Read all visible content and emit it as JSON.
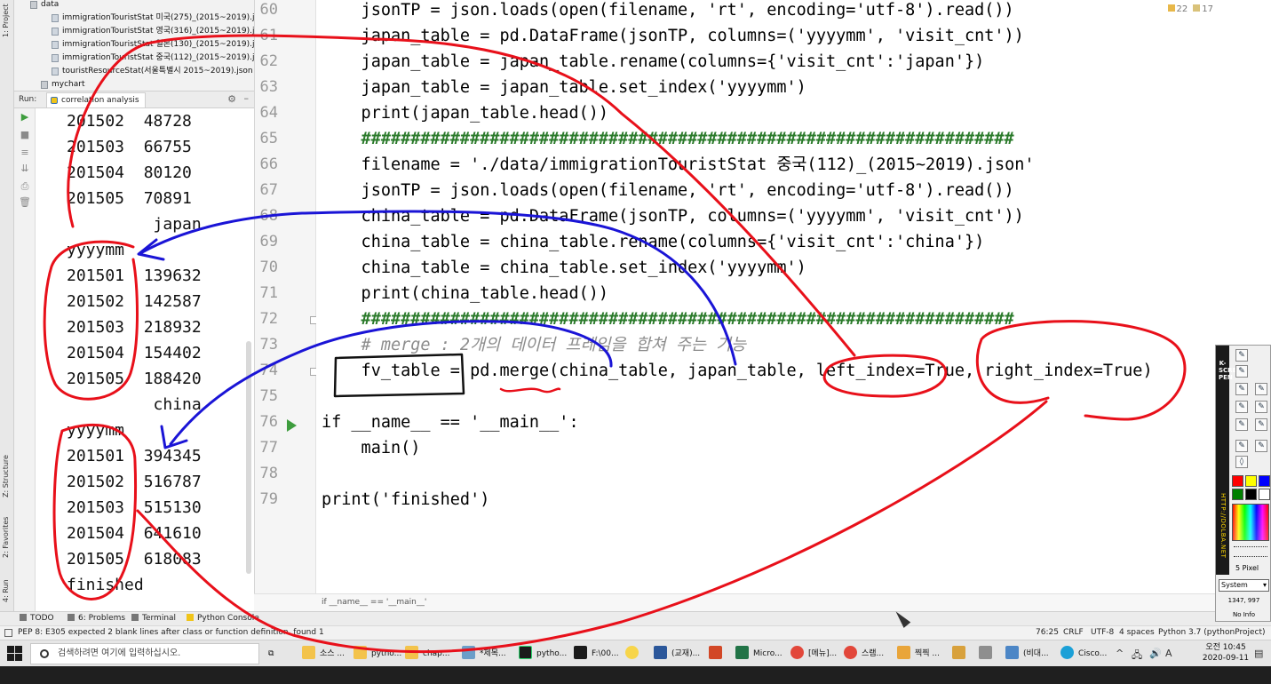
{
  "left_stripe": {
    "project_tab": "1: Project",
    "structure_tab": "Z: Structure",
    "favorites_tab": "2: Favorites",
    "run_tab": "4: Run"
  },
  "project_tree": {
    "items": [
      {
        "label": "data",
        "kind": "folder"
      },
      {
        "label": "immigrationTouristStat 미국(275)_(2015~2019).json",
        "kind": "file"
      },
      {
        "label": "immigrationTouristStat 영국(316)_(2015~2019).json",
        "kind": "file"
      },
      {
        "label": "immigrationTouristStat 일본(130)_(2015~2019).json",
        "kind": "file"
      },
      {
        "label": "immigrationTouristStat 중국(112)_(2015~2019).json",
        "kind": "file"
      },
      {
        "label": "touristResourceStat(서울특별시 2015~2019).json",
        "kind": "file"
      },
      {
        "label": "mychart",
        "kind": "folder"
      }
    ]
  },
  "run_panel": {
    "label": "Run:",
    "tab": "correlation analysis",
    "console_lines": [
      "201502  48728",
      "201503  66755",
      "201504  80120",
      "201505  70891",
      "         japan",
      "yyyymm",
      "201501  139632",
      "201502  142587",
      "201503  218932",
      "201504  154402",
      "201505  188420",
      "         china",
      "yyyymm",
      "201501  394345",
      "201502  516787",
      "201503  515130",
      "201504  641610",
      "201505  618083",
      "finished"
    ]
  },
  "editor": {
    "inspection": {
      "warnings": "22",
      "weak": "17"
    },
    "line_numbers": [
      "60",
      "61",
      "62",
      "63",
      "64",
      "65",
      "66",
      "67",
      "68",
      "69",
      "70",
      "71",
      "72",
      "73",
      "74",
      "75",
      "76",
      "77",
      "78",
      "79"
    ],
    "lines": [
      "    jsonTP = json.loads(open(filename, 'rt', encoding='utf-8').read())",
      "    japan_table = pd.DataFrame(jsonTP, columns=('yyyymm', 'visit_cnt'))",
      "    japan_table = japan_table.rename(columns={'visit_cnt':'japan'})",
      "    japan_table = japan_table.set_index('yyyymm')",
      "    print(japan_table.head())",
      "    ##################################################################",
      "    filename = './data/immigrationTouristStat 중국(112)_(2015~2019).json'",
      "    jsonTP = json.loads(open(filename, 'rt', encoding='utf-8').read())",
      "    china_table = pd.DataFrame(jsonTP, columns=('yyyymm', 'visit_cnt'))",
      "    china_table = china_table.rename(columns={'visit_cnt':'china'})",
      "    china_table = china_table.set_index('yyyymm')",
      "    print(china_table.head())",
      "    ##################################################################",
      "    # merge : 2개의 데이터 프레임을 합쳐 주는 기능",
      "    fv_table = pd.merge(china_table, japan_table, left_index=True, right_index=True)",
      "",
      "if __name__ == '__main__':",
      "    main()",
      "",
      "print('finished')"
    ],
    "breadcrumb": "if __name__ == '__main__'"
  },
  "bottom_tabs": [
    "TODO",
    "6: Problems",
    "Terminal",
    "Python Console"
  ],
  "status_bar": {
    "message": "PEP 8: E305 expected 2 blank lines after class or function definition, found 1",
    "position": "76:25",
    "line_sep": "CRLF",
    "encoding": "UTF-8",
    "indent": "4 spaces",
    "interpreter": "Python 3.7 (pythonProject)"
  },
  "taskbar": {
    "search_placeholder": "검색하려면 여기에 입력하십시오.",
    "tasks": [
      "소스 ...",
      "pytho...",
      "chap...",
      "*제목...",
      "pytho...",
      "F:\\00...",
      "",
      "(교재)...",
      "",
      "Micro...",
      "[메뉴]...",
      "스램...",
      "찍찍 ...",
      "",
      "",
      "(비대...",
      "Cisco..."
    ],
    "time": "오전 10:45",
    "date": "2020-09-11",
    "ime": "A"
  },
  "screen_pen": {
    "vertical_label": "K-SCREEN PEN",
    "url": "HTTP://DOLBA.NET",
    "pixel_label": "5 Pixel",
    "mode": "System",
    "coords": "1347, 997",
    "info": "No Info",
    "colors": [
      "#ff0000",
      "#ffff00",
      "#0000ff",
      "#008000",
      "#000000",
      "#ffffff"
    ]
  },
  "colors": {
    "annotation_red": "#e8101a",
    "annotation_blue": "#1a14d6",
    "run_green": "#3e9d3e"
  }
}
